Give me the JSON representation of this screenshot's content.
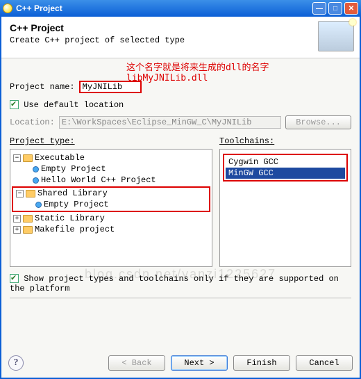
{
  "window": {
    "title": "C++ Project"
  },
  "banner": {
    "heading": "C++ Project",
    "subtitle": "Create C++ project of selected type"
  },
  "annotation": {
    "line1": "这个名字就是将来生成的dll的名字",
    "line2": "libMyJNILib.dll"
  },
  "project_name": {
    "label": "Project name:",
    "value": "MyJNILib"
  },
  "default_location": {
    "label": "Use default location",
    "checked": true
  },
  "location": {
    "label": "Location:",
    "value": "E:\\WorkSpaces\\Eclipse_MinGW_C\\MyJNILib",
    "browse": "Browse..."
  },
  "project_type": {
    "label": "Project type:",
    "groups": [
      {
        "name": "Executable",
        "children": [
          "Empty Project",
          "Hello World C++ Project"
        ],
        "expanded": true
      },
      {
        "name": "Shared Library",
        "children": [
          "Empty Project"
        ],
        "expanded": true
      },
      {
        "name": "Static Library",
        "children": [],
        "expanded": false
      },
      {
        "name": "Makefile project",
        "children": [],
        "expanded": false
      }
    ]
  },
  "toolchains": {
    "label": "Toolchains:",
    "items": [
      "Cygwin GCC",
      "MinGW GCC"
    ],
    "selected_index": 1
  },
  "show_supported": {
    "label": "Show project types and toolchains only if they are supported on the platform",
    "checked": true
  },
  "buttons": {
    "back": "< Back",
    "next": "Next >",
    "finish": "Finish",
    "cancel": "Cancel"
  },
  "watermark": "blog.csdn.net/yanzi1225627"
}
